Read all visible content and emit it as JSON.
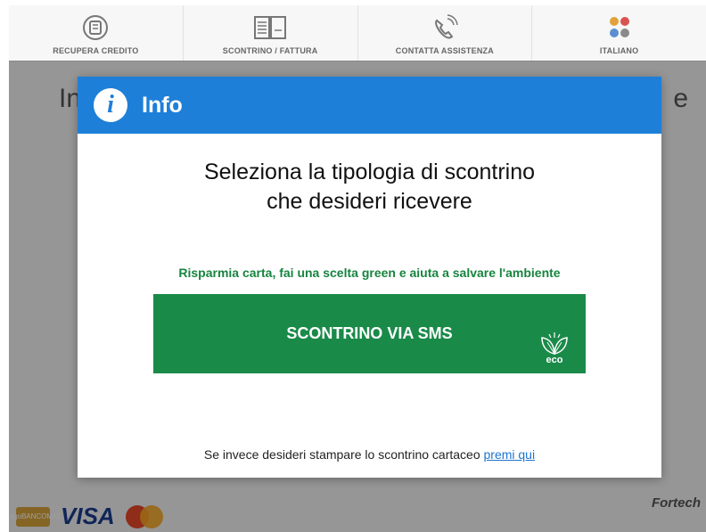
{
  "nav": {
    "items": [
      {
        "label": "RECUPERA CREDITO",
        "icon": "recover-credit-icon"
      },
      {
        "label": "SCONTRINO / FATTURA",
        "icon": "receipt-invoice-icon"
      },
      {
        "label": "CONTATTA ASSISTENZA",
        "icon": "phone-support-icon"
      },
      {
        "label": "ITALIANO",
        "icon": "language-flags-icon"
      }
    ]
  },
  "background": {
    "heading_left": "In",
    "heading_right": "e"
  },
  "modal": {
    "title": "Info",
    "info_glyph": "i",
    "question_line1": "Seleziona la tipologia di scontrino",
    "question_line2": "che desideri ricevere",
    "eco_message": "Risparmia carta, fai una scelta green e aiuta a salvare l'ambiente",
    "sms_button_label": "SCONTRINO VIA SMS",
    "eco_badge_label": "eco",
    "paper_text": "Se invece desideri stampare lo scontrino cartaceo",
    "paper_link": "premi qui"
  },
  "footer": {
    "card_badge": "PagoBANCOMAT",
    "visa": "VISA",
    "brand": "Fortech"
  },
  "colors": {
    "header_blue": "#1e7fd8",
    "green": "#1a8a49",
    "eco_green": "#17843f",
    "link_blue": "#1e74d0"
  }
}
